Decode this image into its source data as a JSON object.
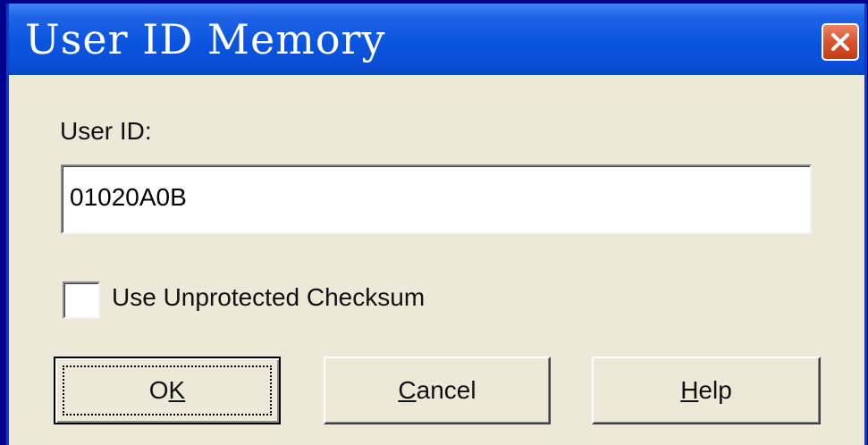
{
  "window": {
    "title": "User ID Memory",
    "close_icon": "close-icon"
  },
  "form": {
    "user_id_label": "User ID:",
    "user_id_value": "01020A0B",
    "checkbox_label": "Use Unprotected Checksum",
    "checkbox_checked": false
  },
  "buttons": {
    "ok": {
      "mnemonic": "",
      "rest": "",
      "label_pre": "O",
      "label_mn": "K",
      "label_post": ""
    },
    "cancel": {
      "label_pre": "",
      "label_mn": "C",
      "label_post": "ancel"
    },
    "help": {
      "label_pre": "",
      "label_mn": "H",
      "label_post": "elp"
    }
  },
  "colors": {
    "desktop": "#00008a",
    "titlebar": "#0a55e0",
    "dialog_face": "#ece9d8",
    "close_button": "#d9542c"
  }
}
